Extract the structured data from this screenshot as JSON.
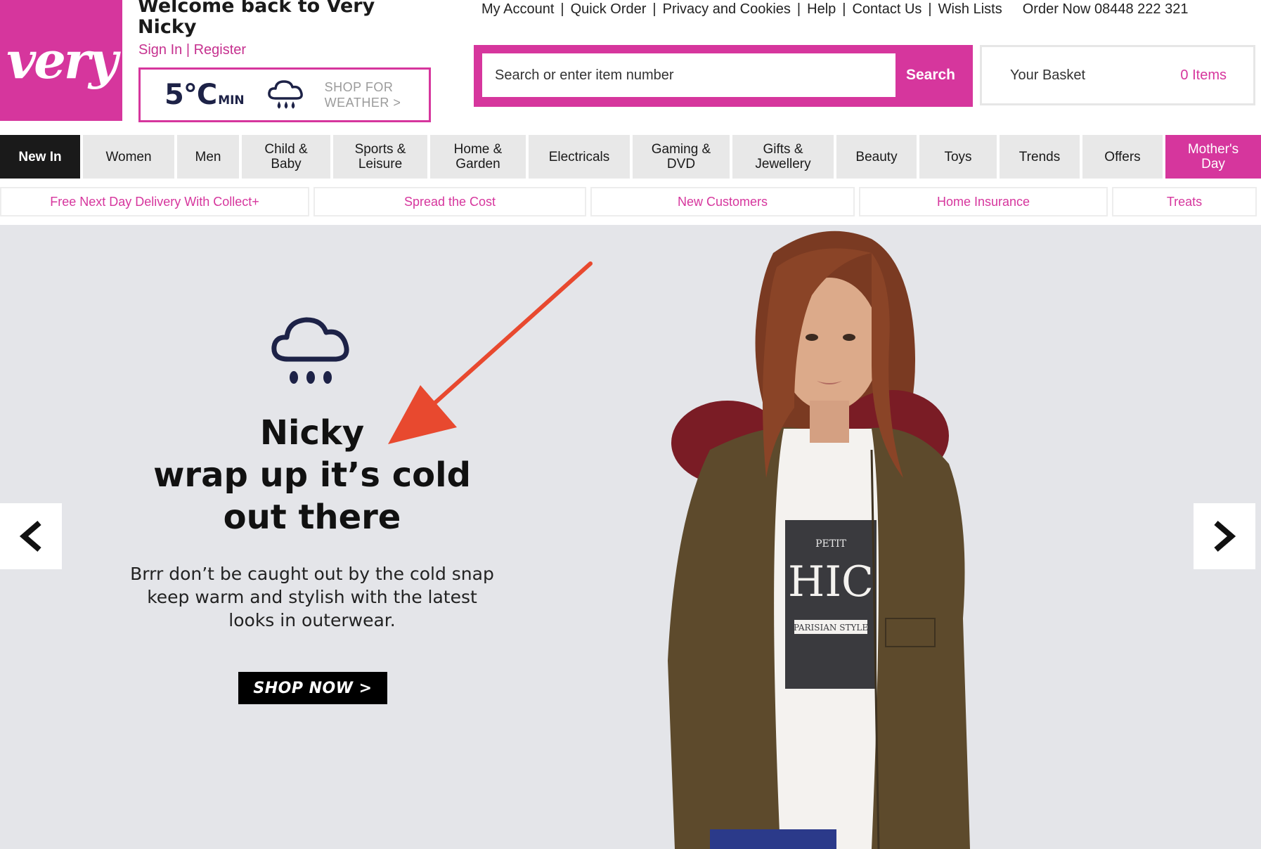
{
  "brand": {
    "logo_text": "very",
    "color": "#d6369d"
  },
  "header": {
    "welcome_line1": "Welcome back to Very",
    "welcome_line2": "Nicky",
    "sign_in": "Sign In",
    "separator": " | ",
    "register": "Register"
  },
  "weather": {
    "temperature": "5°C",
    "unit_label": "MIN",
    "icon": "rain-cloud-icon",
    "cta_line1": "SHOP FOR",
    "cta_line2": "WEATHER >"
  },
  "top_links": [
    {
      "label": "My Account"
    },
    {
      "label": "Quick Order"
    },
    {
      "label": "Privacy and Cookies"
    },
    {
      "label": "Help"
    },
    {
      "label": "Contact Us"
    },
    {
      "label": "Wish Lists"
    }
  ],
  "order_phone": "Order Now 08448 222 321",
  "search": {
    "placeholder": "Search or enter item number",
    "button_label": "Search"
  },
  "basket": {
    "label": "Your Basket",
    "count": "0 Items"
  },
  "nav": [
    {
      "line1": "New In",
      "line2": ""
    },
    {
      "line1": "Women",
      "line2": ""
    },
    {
      "line1": "Men",
      "line2": ""
    },
    {
      "line1": "Child &",
      "line2": "Baby"
    },
    {
      "line1": "Sports &",
      "line2": "Leisure"
    },
    {
      "line1": "Home &",
      "line2": "Garden"
    },
    {
      "line1": "Electricals",
      "line2": ""
    },
    {
      "line1": "Gaming &",
      "line2": "DVD"
    },
    {
      "line1": "Gifts &",
      "line2": "Jewellery"
    },
    {
      "line1": "Beauty",
      "line2": ""
    },
    {
      "line1": "Toys",
      "line2": ""
    },
    {
      "line1": "Trends",
      "line2": ""
    },
    {
      "line1": "Offers",
      "line2": ""
    },
    {
      "line1": "Mother's",
      "line2": "Day"
    }
  ],
  "promo_bar": [
    {
      "label": "Free Next Day Delivery With Collect+"
    },
    {
      "label": "Spread the Cost"
    },
    {
      "label": "New Customers"
    },
    {
      "label": "Home Insurance"
    },
    {
      "label": "Treats"
    }
  ],
  "hero": {
    "icon": "rain-cloud-icon",
    "headline": [
      "Nicky",
      "wrap up it’s cold",
      "out there"
    ],
    "body": [
      "Brrr don’t be caught out by the cold snap",
      "keep warm and stylish with the latest",
      "looks in outerwear."
    ],
    "cta": "SHOP NOW >",
    "prev_icon": "chevron-left-icon",
    "next_icon": "chevron-right-icon",
    "annotation_color": "#e8492f",
    "tshirt_text": [
      "PETIT",
      "HIC",
      "PARISIAN STYLE"
    ]
  }
}
